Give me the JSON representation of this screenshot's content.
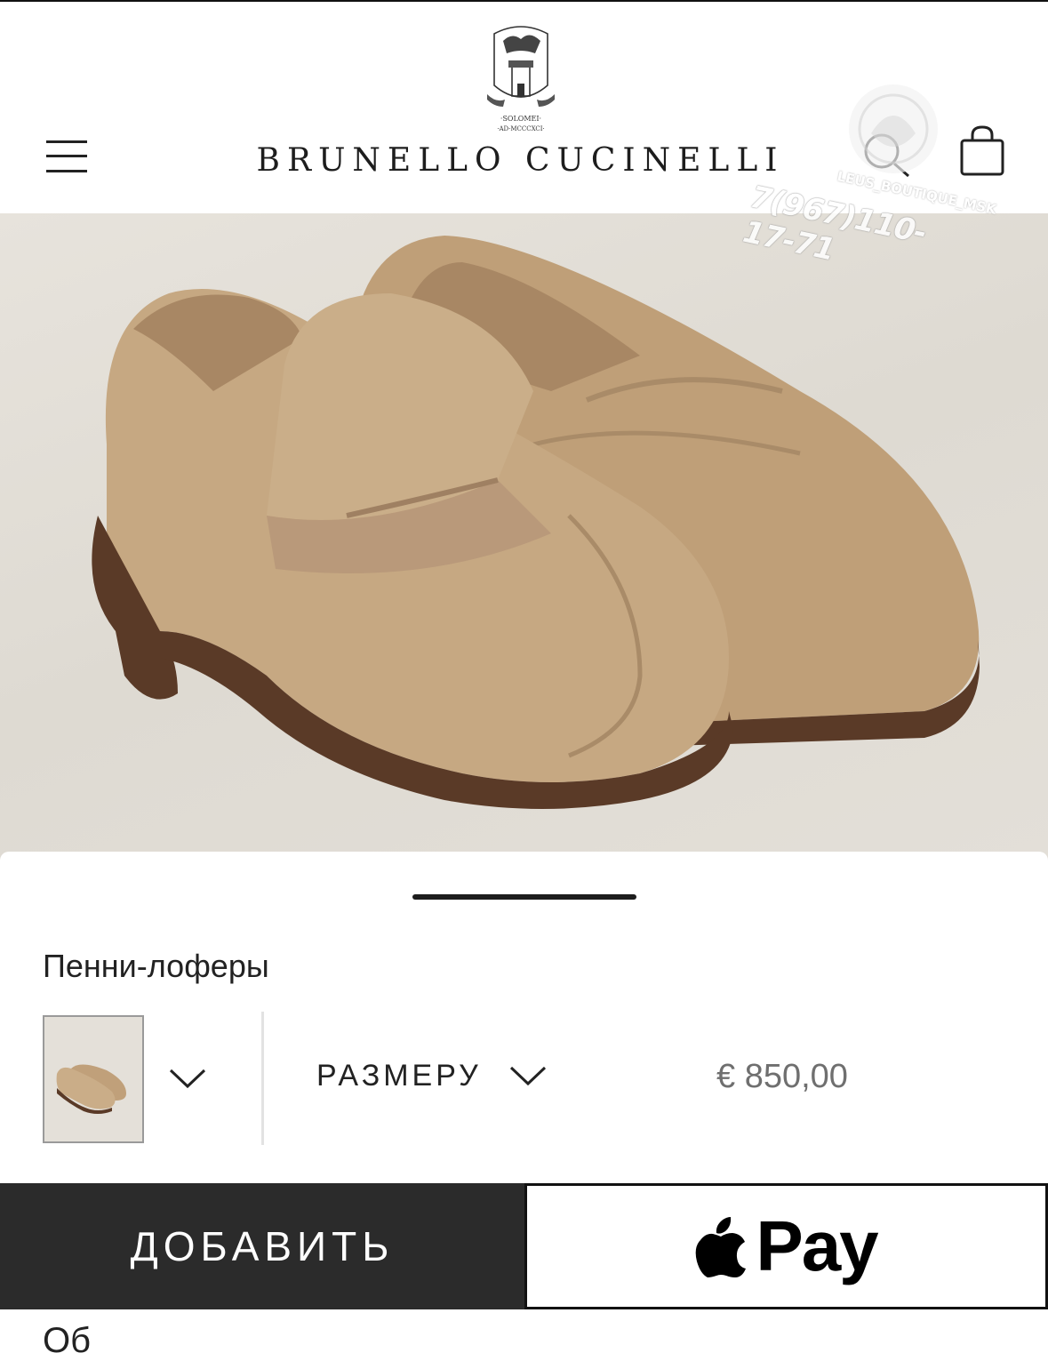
{
  "header": {
    "brand": "BRUNELLO CUCINELLI",
    "crest_line1": "·SOLOMEI·",
    "crest_line2": "·AD·MCCCXCI·",
    "icons": [
      "menu-icon",
      "search-icon",
      "shopping-bag-icon"
    ]
  },
  "watermark": {
    "handle": "LEUS_BOUTIQUE_MSK",
    "phone": "7(967)110-17-71"
  },
  "product": {
    "title": "Пенни-лоферы",
    "size_label": "РАЗМЕРУ",
    "price": "€ 850,00"
  },
  "actions": {
    "add_label": "ДОБАВИТЬ",
    "pay_label": "Pay"
  },
  "footer": {
    "cut_text": "Об"
  },
  "colors": {
    "add_button_bg": "#2b2b2b",
    "price": "#6f6f6f",
    "shoe": "#c6a882",
    "sole": "#5a3a27"
  }
}
